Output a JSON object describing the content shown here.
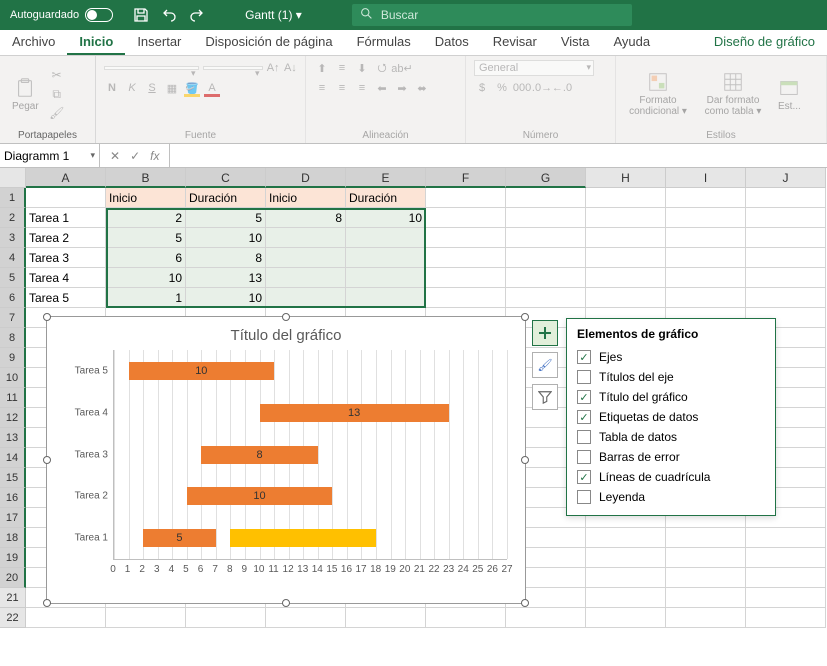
{
  "titlebar": {
    "autosave": "Autoguardado",
    "doc_title": "Gantt (1) ▾",
    "search_placeholder": "Buscar"
  },
  "ribbon_tabs": [
    "Archivo",
    "Inicio",
    "Insertar",
    "Disposición de página",
    "Fórmulas",
    "Datos",
    "Revisar",
    "Vista",
    "Ayuda",
    "Diseño de gráfico"
  ],
  "active_tab": "Inicio",
  "ribbon": {
    "portapapeles": "Portapapeles",
    "pegar": "Pegar",
    "fuente": "Fuente",
    "alineacion": "Alineación",
    "numero": "Número",
    "estilos": "Estilos",
    "general": "General",
    "formato_cond": "Formato condicional ▾",
    "formato_tabla": "Dar formato como tabla ▾",
    "estilos_celda": "Est..."
  },
  "namebox": "Diagramm 1",
  "fx_label": "fx",
  "columns": [
    "A",
    "B",
    "C",
    "D",
    "E",
    "F",
    "G",
    "H",
    "I",
    "J"
  ],
  "rows": [
    "1",
    "2",
    "3",
    "4",
    "5",
    "6",
    "7",
    "8",
    "9",
    "10",
    "11",
    "12",
    "13",
    "14",
    "15",
    "16",
    "17",
    "18",
    "19",
    "20",
    "21",
    "22"
  ],
  "table": {
    "headers": [
      "",
      "Inicio",
      "Duración",
      "Inicio",
      "Duración"
    ],
    "rows": [
      [
        "Tarea 1",
        "2",
        "5",
        "8",
        "10"
      ],
      [
        "Tarea 2",
        "5",
        "10",
        "",
        ""
      ],
      [
        "Tarea 3",
        "6",
        "8",
        "",
        ""
      ],
      [
        "Tarea 4",
        "10",
        "13",
        "",
        ""
      ],
      [
        "Tarea 5",
        "1",
        "10",
        "",
        ""
      ]
    ]
  },
  "chart": {
    "title": "Título del gráfico",
    "xmax": 27
  },
  "chart_data": {
    "type": "bar",
    "title": "Título del gráfico",
    "xlabel": "",
    "ylabel": "",
    "xlim": [
      0,
      27
    ],
    "categories": [
      "Tarea 5",
      "Tarea 4",
      "Tarea 3",
      "Tarea 2",
      "Tarea 1"
    ],
    "series": [
      {
        "name": "Inicio",
        "values": [
          1,
          10,
          6,
          5,
          2
        ],
        "stack": "a",
        "fill": "transparent"
      },
      {
        "name": "Duración",
        "values": [
          10,
          13,
          8,
          10,
          5
        ],
        "stack": "a",
        "fill": "#ed7d31",
        "data_labels": true
      },
      {
        "name": "Inicio2",
        "values": [
          null,
          null,
          null,
          null,
          8
        ],
        "stack": "b",
        "fill": "transparent"
      },
      {
        "name": "Duración2",
        "values": [
          null,
          null,
          null,
          null,
          10
        ],
        "stack": "b",
        "fill": "#ffc000"
      }
    ],
    "xticks": [
      0,
      1,
      2,
      3,
      4,
      5,
      6,
      7,
      8,
      9,
      10,
      11,
      12,
      13,
      14,
      15,
      16,
      17,
      18,
      19,
      20,
      21,
      22,
      23,
      24,
      25,
      26,
      27
    ]
  },
  "chart_elements": {
    "title": "Elementos de gráfico",
    "items": [
      {
        "label": "Ejes",
        "checked": true
      },
      {
        "label": "Títulos del eje",
        "checked": false
      },
      {
        "label": "Título del gráfico",
        "checked": true
      },
      {
        "label": "Etiquetas de datos",
        "checked": true
      },
      {
        "label": "Tabla de datos",
        "checked": false
      },
      {
        "label": "Barras de error",
        "checked": false
      },
      {
        "label": "Líneas de cuadrícula",
        "checked": true
      },
      {
        "label": "Leyenda",
        "checked": false
      }
    ]
  }
}
